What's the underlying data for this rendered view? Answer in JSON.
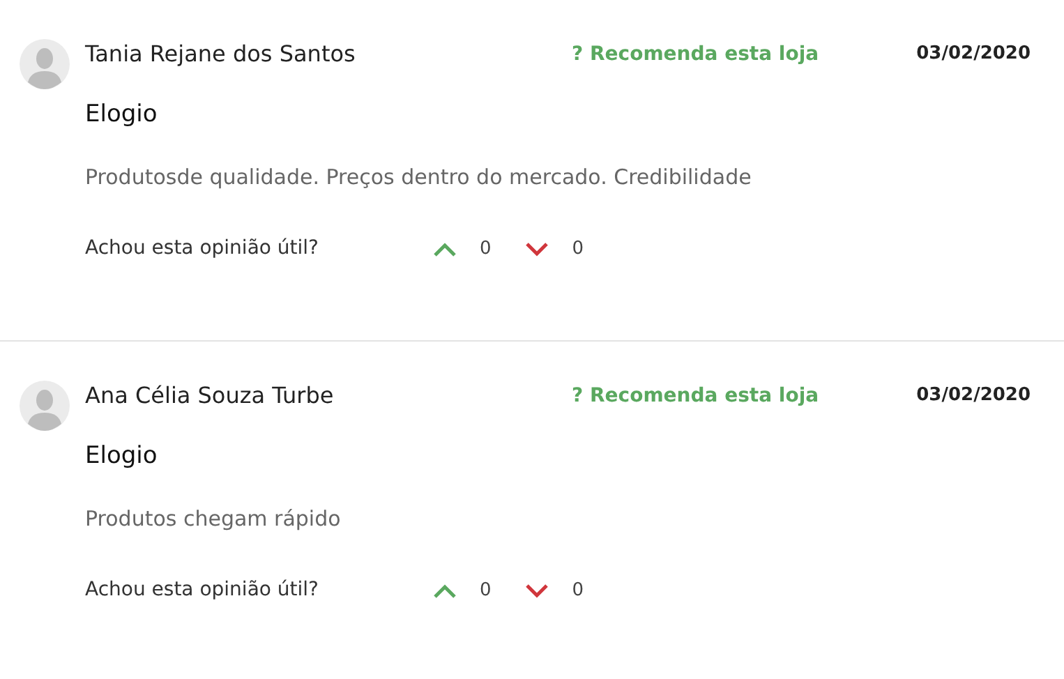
{
  "reviews": [
    {
      "author": "Tania Rejane dos Santos",
      "recommend": "? Recomenda esta loja",
      "date": "03/02/2020",
      "title": "Elogio",
      "text": "Produtosde qualidade. Preços dentro do mercado. Credibilidade",
      "helpful_label": "Achou esta opinião útil?",
      "up_count": "0",
      "down_count": "0"
    },
    {
      "author": "Ana Célia Souza Turbe",
      "recommend": "? Recomenda esta loja",
      "date": "03/02/2020",
      "title": "Elogio",
      "text": "Produtos chegam rápido",
      "helpful_label": "Achou esta opinião útil?",
      "up_count": "0",
      "down_count": "0"
    }
  ]
}
